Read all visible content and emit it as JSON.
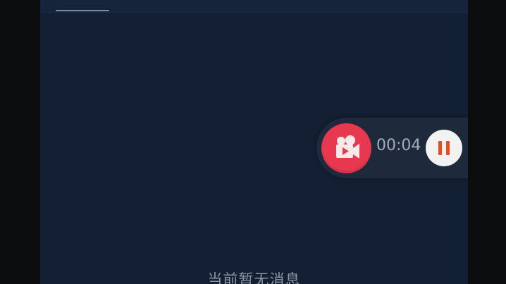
{
  "screen": {
    "empty_message": "当前暂无消息"
  },
  "recorder": {
    "elapsed": "00:04",
    "record_icon": "video-camera-icon",
    "pause_icon": "pause-icon",
    "accent_color": "#e7384f",
    "pause_color": "#e3501d"
  }
}
